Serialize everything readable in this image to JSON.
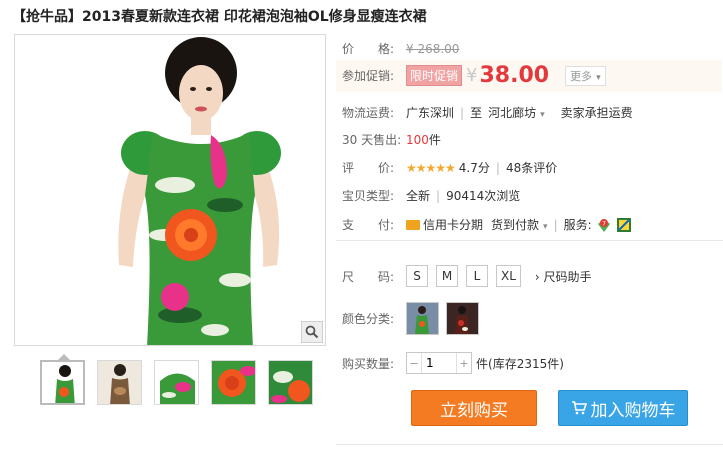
{
  "title": "【抢牛品】2013春夏新款连衣裙 印花裙泡泡袖OL修身显瘦连衣裙",
  "price": {
    "label": "价　　格:",
    "original": "¥ 268.00"
  },
  "promo": {
    "label": "参加促销:",
    "badge": "限时促销",
    "currency": "¥",
    "price": "38.00",
    "more": "更多"
  },
  "shipping": {
    "label": "物流运费:",
    "from": "广东深圳",
    "to_prefix": "至",
    "to": "河北廊坊",
    "fee": "卖家承担运费"
  },
  "sales": {
    "label": "30 天售出:",
    "count": "100",
    "unit": "件"
  },
  "rating": {
    "label": "评　　价:",
    "stars": "★★★★★",
    "score": "4.7分",
    "reviews": "48条评价"
  },
  "type": {
    "label": "宝贝类型:",
    "condition": "全新",
    "views": "90414次浏览"
  },
  "payment": {
    "label": "支　　付:",
    "credit": "信用卡分期",
    "cod": "货到付款",
    "service_label": "服务:"
  },
  "size": {
    "label": "尺　　码:",
    "options": [
      "S",
      "M",
      "L",
      "XL"
    ],
    "helper": "尺码助手"
  },
  "color": {
    "label": "颜色分类:"
  },
  "quantity": {
    "label": "购买数量:",
    "value": "1",
    "unit": "件",
    "stock": "(库存2315件)"
  },
  "actions": {
    "buy": "立刻购买",
    "cart": "加入购物车"
  },
  "colors": {
    "accent": "#e4393c",
    "buy": "#f47b22",
    "cart": "#3aa5e6",
    "dress_green": "#3a9a3a",
    "dress_pink": "#e8328a",
    "dress_orange": "#f0561e"
  }
}
